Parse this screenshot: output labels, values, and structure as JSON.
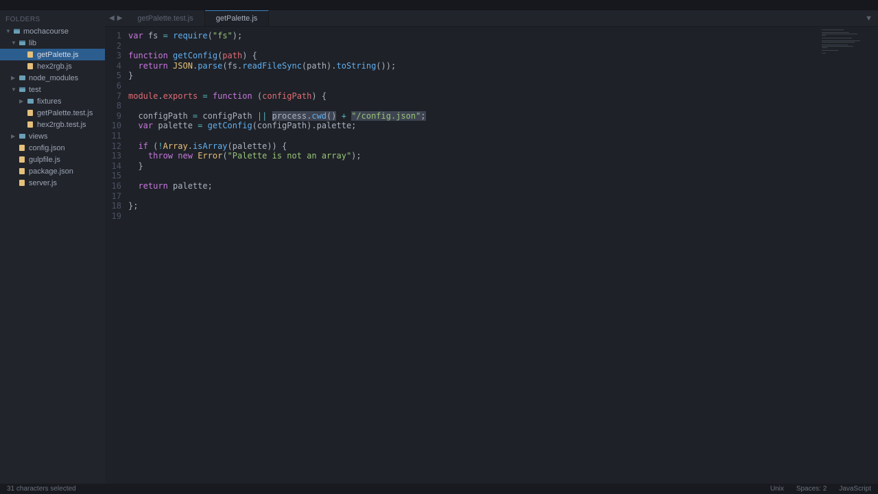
{
  "sidebar": {
    "header": "FOLDERS",
    "items": [
      {
        "label": "mochacourse",
        "indent": 0,
        "type": "folder-open",
        "arrow": "▼"
      },
      {
        "label": "lib",
        "indent": 1,
        "type": "folder-open",
        "arrow": "▼"
      },
      {
        "label": "getPalette.js",
        "indent": 2,
        "type": "file-js",
        "arrow": "",
        "selected": true
      },
      {
        "label": "hex2rgb.js",
        "indent": 2,
        "type": "file-js",
        "arrow": ""
      },
      {
        "label": "node_modules",
        "indent": 1,
        "type": "folder-closed",
        "arrow": "▶"
      },
      {
        "label": "test",
        "indent": 1,
        "type": "folder-open",
        "arrow": "▼"
      },
      {
        "label": "fixtures",
        "indent": 2,
        "type": "folder-closed",
        "arrow": "▶"
      },
      {
        "label": "getPalette.test.js",
        "indent": 2,
        "type": "file-js",
        "arrow": ""
      },
      {
        "label": "hex2rgb.test.js",
        "indent": 2,
        "type": "file-js",
        "arrow": ""
      },
      {
        "label": "views",
        "indent": 1,
        "type": "folder-closed",
        "arrow": "▶"
      },
      {
        "label": "config.json",
        "indent": 1,
        "type": "file-json",
        "arrow": ""
      },
      {
        "label": "gulpfile.js",
        "indent": 1,
        "type": "file-js",
        "arrow": ""
      },
      {
        "label": "package.json",
        "indent": 1,
        "type": "file-json",
        "arrow": ""
      },
      {
        "label": "server.js",
        "indent": 1,
        "type": "file-js",
        "arrow": ""
      }
    ]
  },
  "tabs": {
    "nav_prev": "◀",
    "nav_next": "▶",
    "items": [
      {
        "label": "getPalette.test.js",
        "active": false
      },
      {
        "label": "getPalette.js",
        "active": true
      }
    ],
    "dropdown": "▼"
  },
  "code": {
    "line_count": 19
  },
  "status": {
    "left": "31 characters selected",
    "encoding": "Unix",
    "spaces": "Spaces: 2",
    "lang": "JavaScript"
  }
}
